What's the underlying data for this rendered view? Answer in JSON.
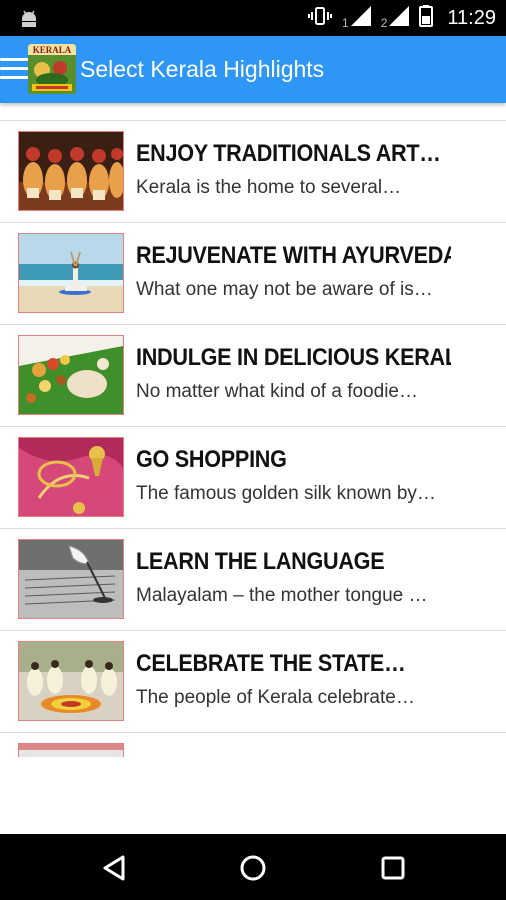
{
  "status_bar": {
    "time": "11:29",
    "sim1_label": "1",
    "sim2_label": "2",
    "icons": [
      "android-debug-icon",
      "vibrate-icon",
      "signal-icon",
      "signal-icon",
      "battery-icon"
    ]
  },
  "app_bar": {
    "title": "Select Kerala Highlights",
    "logo_text": "KERALA",
    "background_color": "#2e97f5",
    "menu_icon": "hamburger-menu-icon"
  },
  "list": {
    "items": [
      {
        "title": "",
        "description": "",
        "image": "partial-item-image"
      },
      {
        "title": "ENJOY TRADITIONALS ART…",
        "description": "Kerala is the home to several…",
        "image": "kathakali-dancers-image"
      },
      {
        "title": "REJUVENATE WITH AYURVEDA",
        "description": "What one may not be aware of is…",
        "image": "yoga-beach-image"
      },
      {
        "title": "INDULGE IN DELICIOUS KERAL…",
        "description": "No matter what kind of a foodie…",
        "image": "banana-leaf-meal-image"
      },
      {
        "title": "GO SHOPPING",
        "description": "The famous golden silk known by…",
        "image": "gold-jewelry-silk-image"
      },
      {
        "title": "LEARN THE LANGUAGE",
        "description": "Malayalam – the mother tongue …",
        "image": "quill-manuscript-image"
      },
      {
        "title": "CELEBRATE THE STATE…",
        "description": "The people of Kerala celebrate…",
        "image": "onam-celebration-image"
      },
      {
        "title": "",
        "description": "",
        "image": "partial-item-image"
      }
    ]
  },
  "nav_bar": {
    "icons": [
      "back-icon",
      "home-icon",
      "recents-icon"
    ]
  }
}
